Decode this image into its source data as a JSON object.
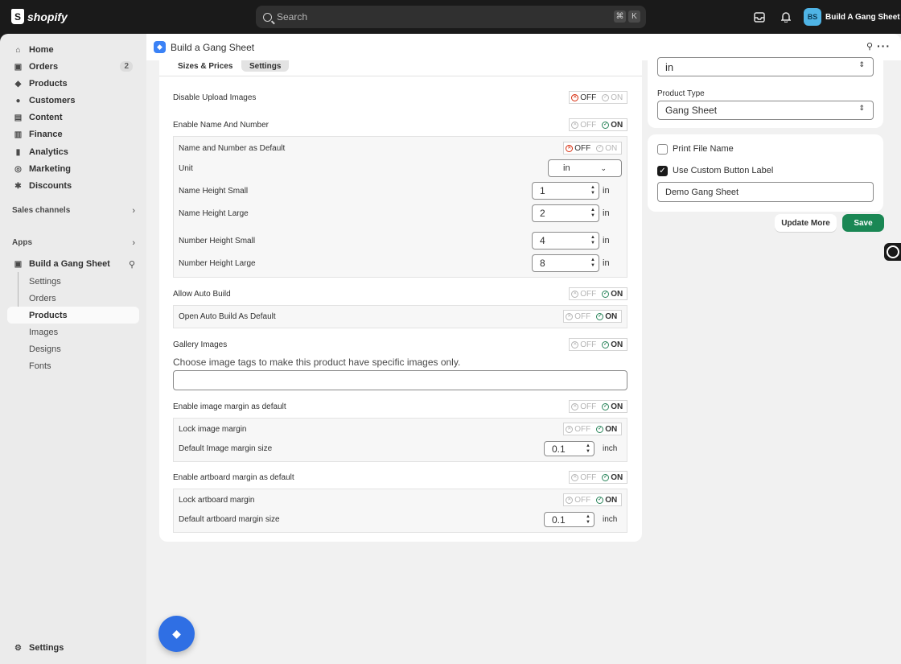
{
  "topbar": {
    "brand": "shopify",
    "search_placeholder": "Search",
    "shortcut_cmd": "⌘",
    "shortcut_key": "K",
    "store_initials": "BS",
    "store_name": "Build A Gang Sheet"
  },
  "sidebar": {
    "items": [
      {
        "label": "Home",
        "icon": "home-icon"
      },
      {
        "label": "Orders",
        "icon": "orders-icon",
        "badge": "2"
      },
      {
        "label": "Products",
        "icon": "tag-icon"
      },
      {
        "label": "Customers",
        "icon": "person-icon"
      },
      {
        "label": "Content",
        "icon": "content-icon"
      },
      {
        "label": "Finance",
        "icon": "bank-icon"
      },
      {
        "label": "Analytics",
        "icon": "chart-icon"
      },
      {
        "label": "Marketing",
        "icon": "target-icon"
      },
      {
        "label": "Discounts",
        "icon": "discount-icon"
      }
    ],
    "sales_channels": "Sales channels",
    "apps": "Apps",
    "app_name": "Build a Gang Sheet",
    "app_subitems": [
      "Settings",
      "Orders",
      "Products",
      "Images",
      "Designs",
      "Fonts"
    ],
    "settings": "Settings"
  },
  "header": {
    "title": "Build a Gang Sheet"
  },
  "tabs": [
    "Sizes & Prices",
    "Settings"
  ],
  "toggle": {
    "off": "OFF",
    "on": "ON"
  },
  "form": {
    "disable_upload_images": "Disable Upload Images",
    "enable_name_number": "Enable Name And Number",
    "name_number_default": "Name and Number as Default",
    "unit": "Unit",
    "unit_value": "in",
    "name_height_small": "Name Height Small",
    "name_height_small_value": "1",
    "name_height_large": "Name Height Large",
    "name_height_large_value": "2",
    "number_height_small": "Number Height Small",
    "number_height_small_value": "4",
    "number_height_large": "Number Height Large",
    "number_height_large_value": "8",
    "unit_in": "in",
    "allow_auto_build": "Allow Auto Build",
    "open_auto_build_default": "Open Auto Build As Default",
    "gallery_images": "Gallery Images",
    "gallery_desc": "Choose image tags to make this product have specific images only.",
    "enable_image_margin": "Enable image margin as default",
    "lock_image_margin": "Lock image margin",
    "default_image_margin": "Default Image margin size",
    "image_margin_value": "0.1",
    "unit_inch": "inch",
    "enable_artboard_margin": "Enable artboard margin as default",
    "lock_artboard_margin": "Lock artboard margin",
    "default_artboard_margin": "Default artboard margin size",
    "artboard_margin_value": "0.1"
  },
  "right": {
    "unit_select_value": "in",
    "product_type_label": "Product Type",
    "product_type_value": "Gang Sheet",
    "print_file_name": "Print File Name",
    "use_custom_button_label": "Use Custom Button Label",
    "custom_button_value": "Demo Gang Sheet",
    "update_more": "Update More",
    "save": "Save"
  },
  "colors": {
    "primary_button": "#1a8754",
    "on_indicator": "#29845a",
    "off_indicator": "#d72c0d",
    "app_accent": "#3b82f6"
  }
}
